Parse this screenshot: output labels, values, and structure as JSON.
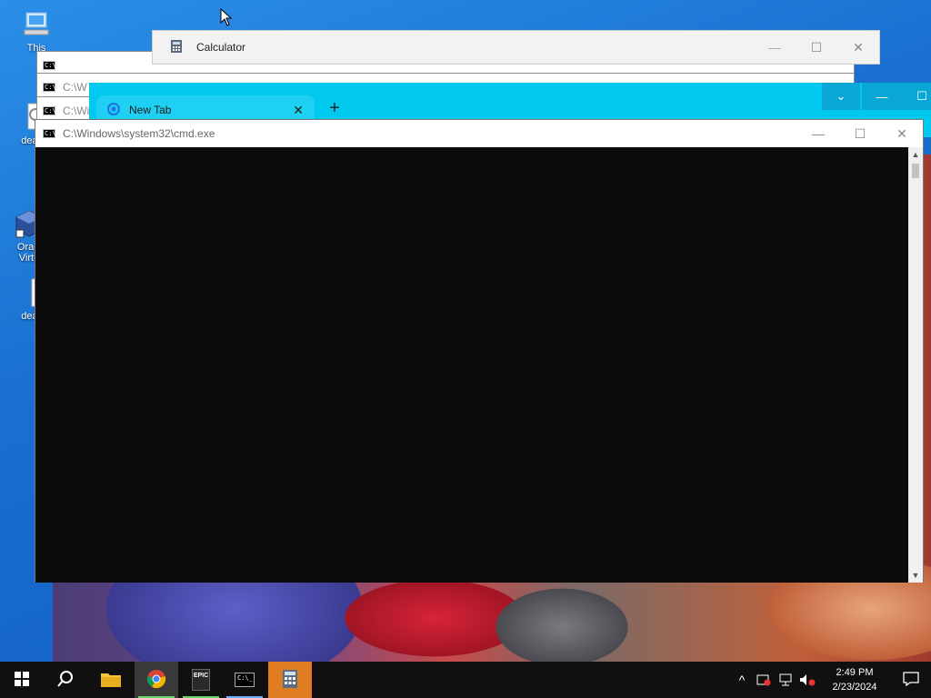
{
  "desktop_icons": [
    {
      "label": "This",
      "icon": "computer-icon"
    },
    {
      "label": "deat",
      "icon": "settings-file-icon"
    },
    {
      "label": "Oracl\nVirtu",
      "icon": "virtualbox-icon"
    },
    {
      "label": "deat",
      "icon": "text-file-icon"
    }
  ],
  "calculator_window": {
    "title": "Calculator",
    "min": "—",
    "max": "☐",
    "close": "✕"
  },
  "background_cmd_windows": [
    {
      "title": "C:\\"
    },
    {
      "title": "C:\\W"
    },
    {
      "title": "C:\\Wi"
    }
  ],
  "chrome_window": {
    "tab_title": "New Tab",
    "tab_close": "✕",
    "new_tab": "+",
    "tab_list": "⌄",
    "minimize": "—",
    "maximize": "☐",
    "accent": "#00c8ee"
  },
  "cmd_window": {
    "title": "C:\\Windows\\system32\\cmd.exe",
    "min": "—",
    "max": "☐",
    "close": "✕",
    "background": "#0c0c0c"
  },
  "taskbar": {
    "pinned": [
      {
        "name": "start",
        "icon": "windows-logo-icon"
      },
      {
        "name": "search",
        "icon": "search-icon"
      },
      {
        "name": "file-explorer",
        "icon": "folder-icon"
      },
      {
        "name": "chrome",
        "icon": "chrome-icon",
        "active": true
      },
      {
        "name": "epic-games",
        "icon": "epic-games-icon",
        "label": "EPIC\nGAMES"
      },
      {
        "name": "cmd",
        "icon": "terminal-icon"
      },
      {
        "name": "calculator",
        "icon": "calculator-icon",
        "active": true
      }
    ],
    "tray": {
      "overflow": "^",
      "time": "2:49 PM",
      "date": "2/23/2024"
    }
  }
}
